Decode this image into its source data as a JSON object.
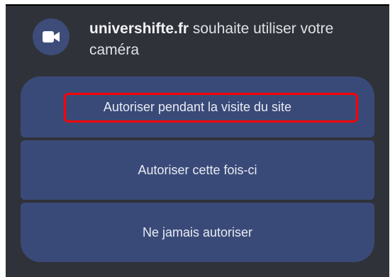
{
  "prompt": {
    "domain": "univershifte.fr",
    "message": " souhaite utiliser votre caméra",
    "icon": "videocam-icon"
  },
  "buttons": {
    "allow_while_visiting": "Autoriser pendant la visite du site",
    "allow_this_time": "Autoriser cette fois-ci",
    "never_allow": "Ne jamais autoriser"
  },
  "colors": {
    "dialog_bg": "#2f3238",
    "button_bg": "#3a4a78",
    "icon_circle": "#3d4c79",
    "highlight": "#ff0000"
  }
}
